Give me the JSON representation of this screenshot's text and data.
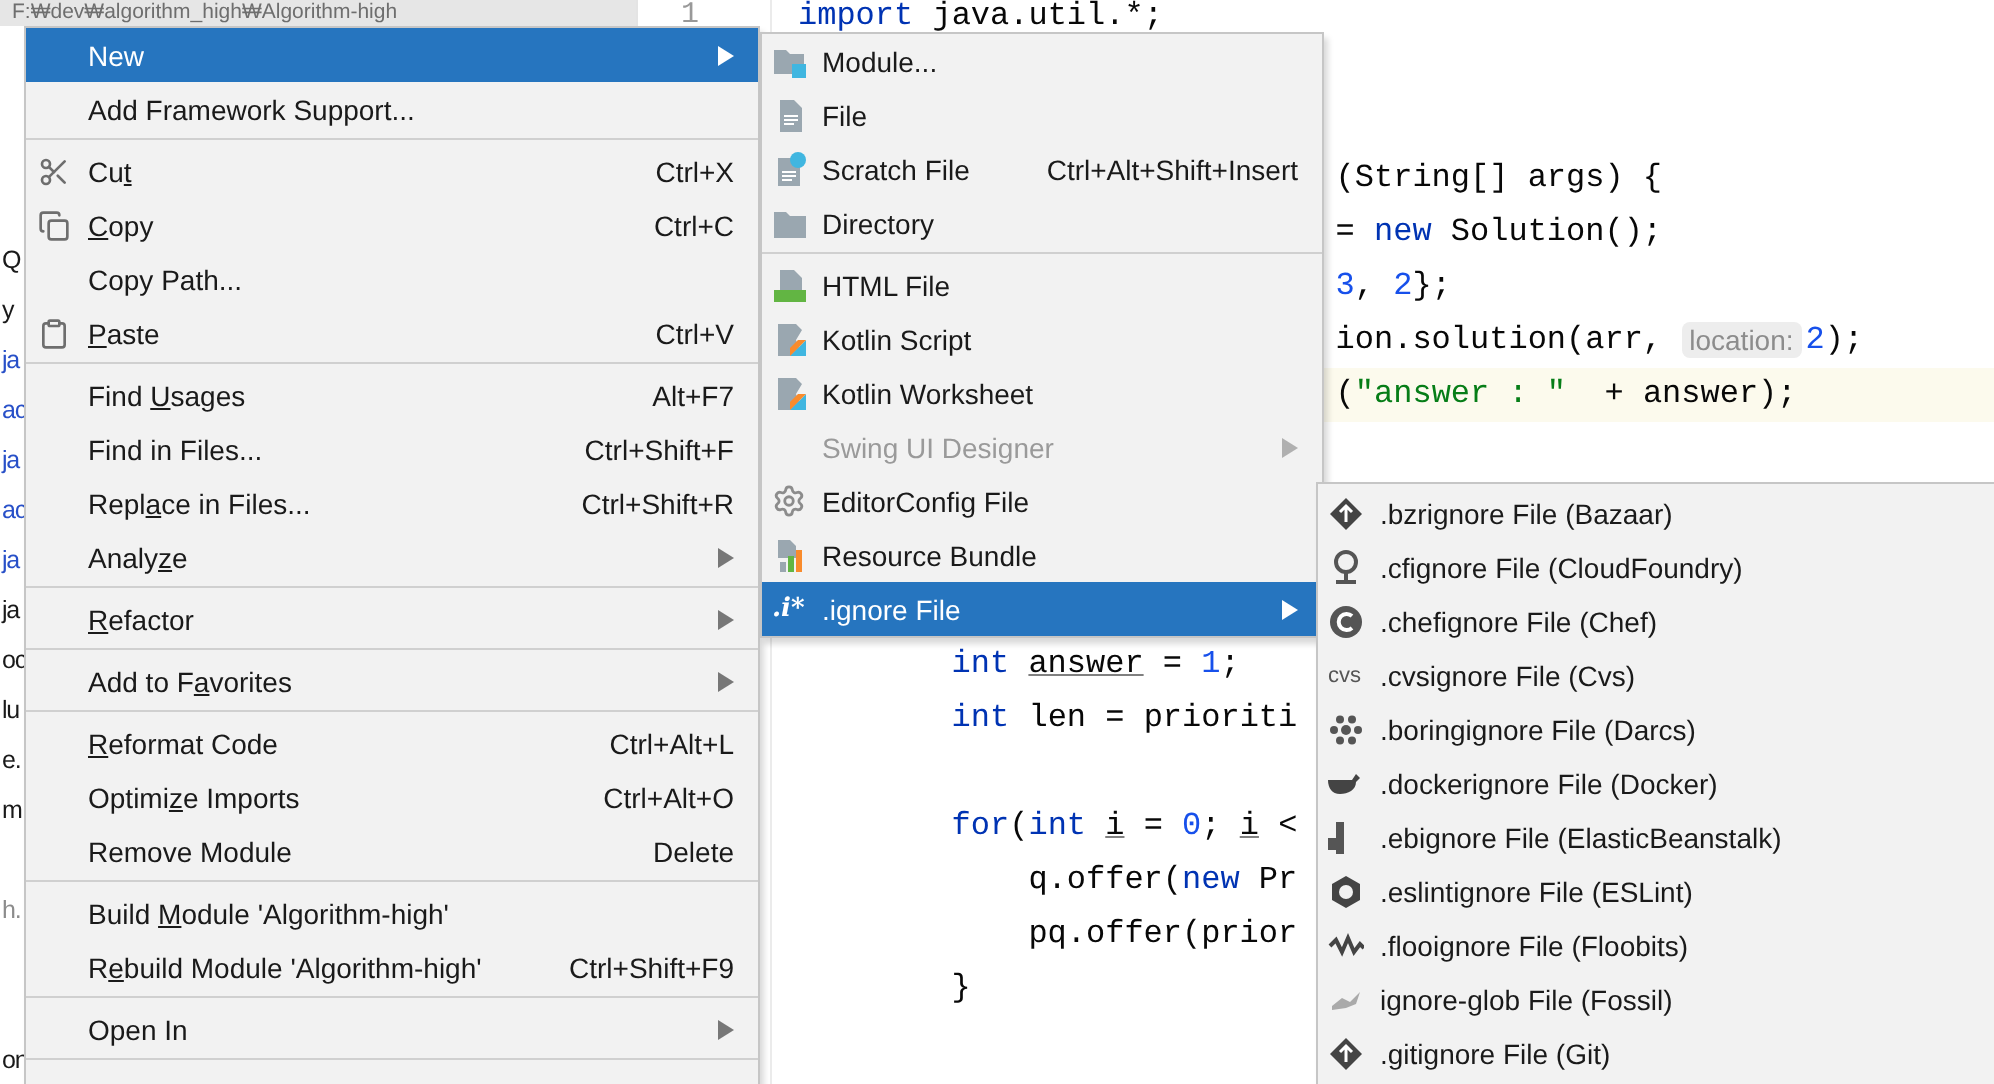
{
  "project_pane": {
    "path": "F:₩dev₩algorithm_high₩Algorithm-high",
    "tree_rows": [
      {
        "kind": "entry",
        "text": "Q",
        "color": "#1a1a1a"
      },
      {
        "kind": "entry",
        "text": "y",
        "color": "#1a1a1a"
      },
      {
        "kind": "entry",
        "text": "ja",
        "color": "#2850c8"
      },
      {
        "kind": "entry",
        "text": "ac",
        "color": "#2850c8"
      },
      {
        "kind": "entry",
        "text": "ja",
        "color": "#2850c8"
      },
      {
        "kind": "entry",
        "text": "ac",
        "color": "#2850c8"
      },
      {
        "kind": "entry",
        "text": "ja",
        "color": "#2850c8"
      },
      {
        "kind": "entry",
        "text": "ja",
        "color": "#1a1a1a"
      },
      {
        "kind": "entry",
        "text": "oc",
        "color": "#1a1a1a"
      },
      {
        "kind": "entry",
        "text": "lu",
        "color": "#1a1a1a"
      },
      {
        "kind": "entry",
        "text": "e.",
        "color": "#1a1a1a"
      },
      {
        "kind": "entry",
        "text": "m",
        "color": "#1a1a1a"
      },
      {
        "kind": "blank"
      },
      {
        "kind": "entry",
        "text": "h.",
        "color": "#8c8c8c"
      },
      {
        "kind": "blank"
      },
      {
        "kind": "blank"
      },
      {
        "kind": "entry",
        "text": "on",
        "color": "#1a1a1a"
      }
    ]
  },
  "gutter": {
    "line_number": "1"
  },
  "editor": {
    "lines": [
      {
        "kind": "top",
        "highlighted": false,
        "segments": [
          {
            "kind": "keyword",
            "text": "import"
          },
          {
            "kind": "plain",
            "text": " java.util.*;"
          }
        ]
      },
      {
        "kind": "blank"
      },
      {
        "kind": "blank"
      },
      {
        "kind": "tail",
        "highlighted": false,
        "segments": [
          {
            "kind": "plain",
            "text": "(String[] args) {"
          }
        ]
      },
      {
        "kind": "tail",
        "highlighted": false,
        "segments": [
          {
            "kind": "plain",
            "text": "= "
          },
          {
            "kind": "keyword",
            "text": "new"
          },
          {
            "kind": "plain",
            "text": " Solution();"
          }
        ]
      },
      {
        "kind": "tail",
        "highlighted": false,
        "segments": [
          {
            "kind": "number",
            "text": "3"
          },
          {
            "kind": "plain",
            "text": ", "
          },
          {
            "kind": "number",
            "text": "2"
          },
          {
            "kind": "plain",
            "text": "};"
          }
        ]
      },
      {
        "kind": "tail",
        "highlighted": false,
        "segments": [
          {
            "kind": "plain",
            "text": "ion.solution(arr, "
          },
          {
            "kind": "hint",
            "text": "location:"
          },
          {
            "kind": "number",
            "text": "2"
          },
          {
            "kind": "plain",
            "text": ");"
          }
        ]
      },
      {
        "kind": "tail",
        "highlighted": true,
        "segments": [
          {
            "kind": "plain",
            "text": "("
          },
          {
            "kind": "string",
            "text": "\"answer : \""
          },
          {
            "kind": "plain",
            "text": "  + answer);"
          }
        ]
      },
      {
        "kind": "blank"
      },
      {
        "kind": "blank"
      },
      {
        "kind": "blank"
      },
      {
        "kind": "blank"
      },
      {
        "kind": "level2",
        "highlighted": false,
        "segments": [
          {
            "kind": "keyword",
            "text": "int "
          },
          {
            "kind": "underlined",
            "text": "answer"
          },
          {
            "kind": "plain",
            "text": " = "
          },
          {
            "kind": "number",
            "text": "1"
          },
          {
            "kind": "plain",
            "text": ";"
          }
        ]
      },
      {
        "kind": "level2",
        "highlighted": false,
        "segments": [
          {
            "kind": "keyword",
            "text": "int"
          },
          {
            "kind": "plain",
            "text": " len = prioriti"
          }
        ]
      },
      {
        "kind": "blank"
      },
      {
        "kind": "level2",
        "highlighted": false,
        "segments": [
          {
            "kind": "keyword",
            "text": "for"
          },
          {
            "kind": "plain",
            "text": "("
          },
          {
            "kind": "keyword",
            "text": "int "
          },
          {
            "kind": "underlined",
            "text": "i"
          },
          {
            "kind": "plain",
            "text": " = "
          },
          {
            "kind": "number",
            "text": "0"
          },
          {
            "kind": "plain",
            "text": "; "
          },
          {
            "kind": "underlined",
            "text": "i"
          },
          {
            "kind": "plain",
            "text": " <"
          }
        ]
      },
      {
        "kind": "level3",
        "highlighted": false,
        "segments": [
          {
            "kind": "plain",
            "text": "q.offer("
          },
          {
            "kind": "keyword",
            "text": "new"
          },
          {
            "kind": "plain",
            "text": " Pr"
          }
        ]
      },
      {
        "kind": "level3",
        "highlighted": false,
        "segments": [
          {
            "kind": "plain",
            "text": "pq.offer(prior"
          }
        ]
      },
      {
        "kind": "level2",
        "highlighted": false,
        "segments": [
          {
            "kind": "plain",
            "text": "}"
          }
        ]
      }
    ]
  },
  "context_menu": {
    "items": [
      {
        "kind": "item",
        "label": [
          {
            "text": "New"
          }
        ],
        "selected": true,
        "submenu": true
      },
      {
        "kind": "item",
        "label": [
          {
            "text": "Add Framework Support..."
          }
        ],
        "selected": false,
        "submenu": false
      },
      {
        "kind": "separator"
      },
      {
        "kind": "item",
        "label": [
          {
            "text": "Cu"
          },
          {
            "text": "t",
            "underlined": true
          }
        ],
        "shortcut": "Ctrl+X",
        "selected": false,
        "submenu": false
      },
      {
        "kind": "item",
        "label": [
          {
            "text": "C",
            "underlined": true
          },
          {
            "text": "opy"
          }
        ],
        "shortcut": "Ctrl+C",
        "selected": false,
        "submenu": false
      },
      {
        "kind": "item",
        "label": [
          {
            "text": "Copy Path..."
          }
        ],
        "selected": false,
        "submenu": false
      },
      {
        "kind": "item",
        "label": [
          {
            "text": "P",
            "underlined": true
          },
          {
            "text": "aste"
          }
        ],
        "shortcut": "Ctrl+V",
        "selected": false,
        "submenu": false
      },
      {
        "kind": "separator"
      },
      {
        "kind": "item",
        "label": [
          {
            "text": "Find "
          },
          {
            "text": "U",
            "underlined": true
          },
          {
            "text": "sages"
          }
        ],
        "shortcut": "Alt+F7",
        "selected": false,
        "submenu": false
      },
      {
        "kind": "item",
        "label": [
          {
            "text": "Find in Files..."
          }
        ],
        "shortcut": "Ctrl+Shift+F",
        "selected": false,
        "submenu": false
      },
      {
        "kind": "item",
        "label": [
          {
            "text": "Repl"
          },
          {
            "text": "a",
            "underlined": true
          },
          {
            "text": "ce in Files..."
          }
        ],
        "shortcut": "Ctrl+Shift+R",
        "selected": false,
        "submenu": false
      },
      {
        "kind": "item",
        "label": [
          {
            "text": "Analy"
          },
          {
            "text": "z",
            "underlined": true
          },
          {
            "text": "e"
          }
        ],
        "selected": false,
        "submenu": true
      },
      {
        "kind": "separator"
      },
      {
        "kind": "item",
        "label": [
          {
            "text": "R",
            "underlined": true
          },
          {
            "text": "efactor"
          }
        ],
        "selected": false,
        "submenu": true
      },
      {
        "kind": "separator"
      },
      {
        "kind": "item",
        "label": [
          {
            "text": "Add to F"
          },
          {
            "text": "a",
            "underlined": true
          },
          {
            "text": "vorites"
          }
        ],
        "selected": false,
        "submenu": true
      },
      {
        "kind": "separator"
      },
      {
        "kind": "item",
        "label": [
          {
            "text": "R",
            "underlined": true
          },
          {
            "text": "eformat Code"
          }
        ],
        "shortcut": "Ctrl+Alt+L",
        "selected": false,
        "submenu": false
      },
      {
        "kind": "item",
        "label": [
          {
            "text": "Optimi"
          },
          {
            "text": "z",
            "underlined": true
          },
          {
            "text": "e Imports"
          }
        ],
        "shortcut": "Ctrl+Alt+O",
        "selected": false,
        "submenu": false
      },
      {
        "kind": "item",
        "label": [
          {
            "text": "Remove Module"
          }
        ],
        "shortcut": "Delete",
        "selected": false,
        "submenu": false
      },
      {
        "kind": "separator"
      },
      {
        "kind": "item",
        "label": [
          {
            "text": "Build "
          },
          {
            "text": "M",
            "underlined": true
          },
          {
            "text": "odule 'Algorithm-high'"
          }
        ],
        "selected": false,
        "submenu": false
      },
      {
        "kind": "item",
        "label": [
          {
            "text": "R"
          },
          {
            "text": "e",
            "underlined": true
          },
          {
            "text": "build Module 'Algorithm-high'"
          }
        ],
        "shortcut": "Ctrl+Shift+F9",
        "selected": false,
        "submenu": false
      },
      {
        "kind": "separator"
      },
      {
        "kind": "item",
        "label": [
          {
            "text": "Open In"
          }
        ],
        "selected": false,
        "submenu": true
      },
      {
        "kind": "separator"
      }
    ]
  },
  "new_submenu": {
    "items": [
      {
        "kind": "item",
        "label": "Module...",
        "selected": false,
        "disabled": false,
        "submenu": false
      },
      {
        "kind": "item",
        "label": "File",
        "selected": false,
        "disabled": false,
        "submenu": false
      },
      {
        "kind": "item",
        "label": "Scratch File",
        "shortcut": "Ctrl+Alt+Shift+Insert",
        "selected": false,
        "disabled": false,
        "submenu": false
      },
      {
        "kind": "item",
        "label": "Directory",
        "selected": false,
        "disabled": false,
        "submenu": false
      },
      {
        "kind": "separator"
      },
      {
        "kind": "item",
        "label": "HTML File",
        "selected": false,
        "disabled": false,
        "submenu": false
      },
      {
        "kind": "item",
        "label": "Kotlin Script",
        "selected": false,
        "disabled": false,
        "submenu": false
      },
      {
        "kind": "item",
        "label": "Kotlin Worksheet",
        "selected": false,
        "disabled": false,
        "submenu": false
      },
      {
        "kind": "item",
        "label": "Swing UI Designer",
        "selected": false,
        "disabled": true,
        "submenu": true
      },
      {
        "kind": "item",
        "label": "EditorConfig File",
        "selected": false,
        "disabled": false,
        "submenu": false
      },
      {
        "kind": "item",
        "label": "Resource Bundle",
        "selected": false,
        "disabled": false,
        "submenu": false
      },
      {
        "kind": "item",
        "label": ".ignore File",
        "icon_text": ".i*",
        "selected": true,
        "disabled": false,
        "submenu": true
      }
    ]
  },
  "ignore_submenu": {
    "items": [
      {
        "label": ".bzrignore File (Bazaar)"
      },
      {
        "label": ".cfignore File (CloudFoundry)"
      },
      {
        "label": ".chefignore File (Chef)"
      },
      {
        "label": ".cvsignore File (Cvs)",
        "icon_text": "cvs"
      },
      {
        "label": ".boringignore File (Darcs)"
      },
      {
        "label": ".dockerignore File (Docker)"
      },
      {
        "label": ".ebignore File (ElasticBeanstalk)"
      },
      {
        "label": ".eslintignore File (ESLint)"
      },
      {
        "label": ".flooignore File (Floobits)"
      },
      {
        "label": "ignore-glob File (Fossil)"
      },
      {
        "label": ".gitignore File (Git)"
      }
    ]
  }
}
